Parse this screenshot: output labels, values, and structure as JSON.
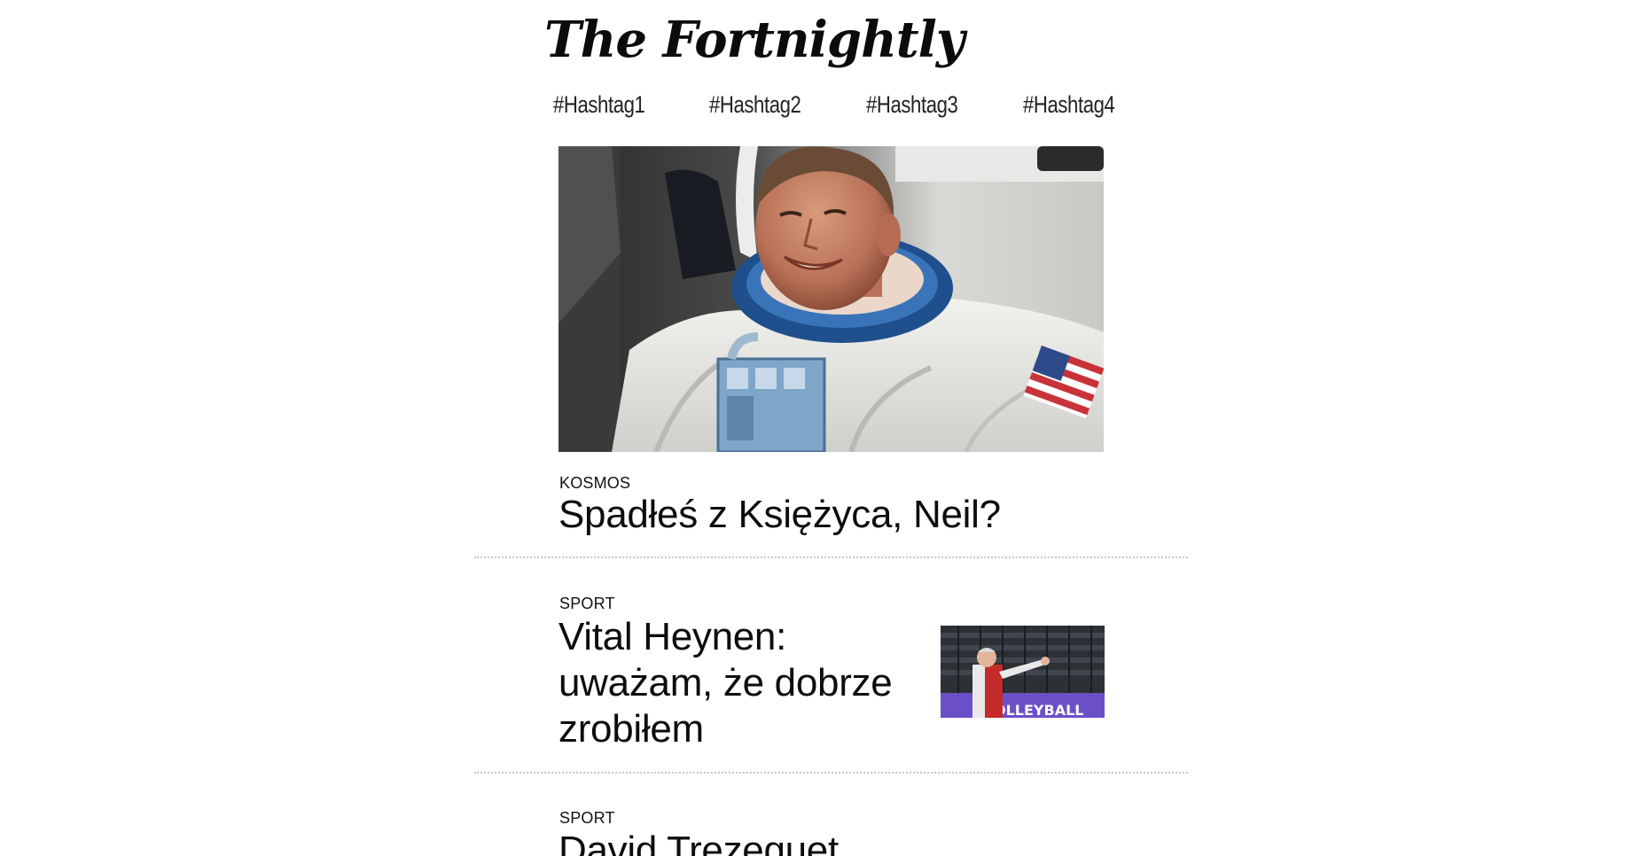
{
  "site": {
    "title": "The Fortnightly"
  },
  "nav": {
    "items": [
      {
        "label": "#Hashtag1"
      },
      {
        "label": "#Hashtag2"
      },
      {
        "label": "#Hashtag3"
      },
      {
        "label": "#Hashtag4"
      }
    ]
  },
  "articles": [
    {
      "category": "KOSMOS",
      "headline": "Spadłeś z Księżyca, Neil?",
      "image": "astronaut-photo"
    },
    {
      "category": "SPORT",
      "headline_lines": [
        "Vital Heynen:",
        "uważam, że dobrze",
        "zrobiłem"
      ],
      "image": "volleyball-coach-photo"
    },
    {
      "category": "SPORT",
      "headline": "David Trezeguet"
    }
  ],
  "colors": {
    "background": "#ffffff",
    "text": "#111111",
    "divider": "#c8c8c8"
  }
}
